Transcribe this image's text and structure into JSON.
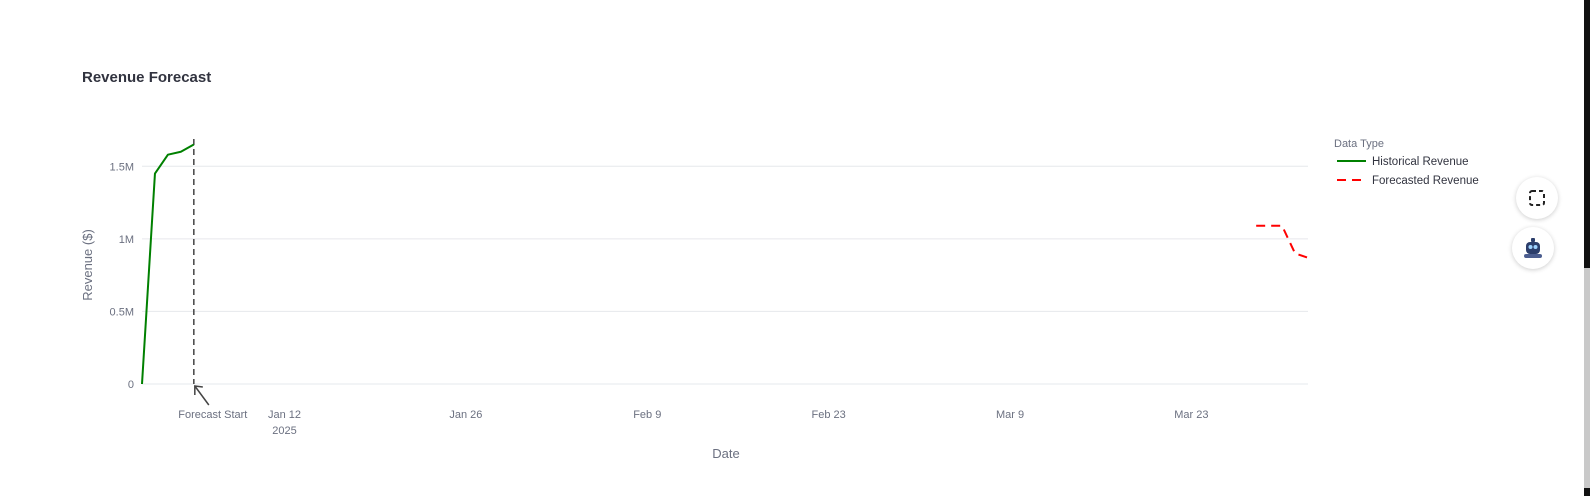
{
  "chart_data": {
    "type": "line",
    "title": "Revenue Forecast",
    "xlabel": "Date",
    "ylabel": "Revenue ($)",
    "xlim": [
      "2025-01-01",
      "2025-04-01"
    ],
    "ylim": [
      0,
      1750000
    ],
    "grid": true,
    "x_ticks": [
      {
        "date": "2025-01-12",
        "label": "Jan 12",
        "sublabel": "2025"
      },
      {
        "date": "2025-01-26",
        "label": "Jan 26"
      },
      {
        "date": "2025-02-09",
        "label": "Feb 9"
      },
      {
        "date": "2025-02-23",
        "label": "Feb 23"
      },
      {
        "date": "2025-03-09",
        "label": "Mar 9"
      },
      {
        "date": "2025-03-23",
        "label": "Mar 23"
      }
    ],
    "y_ticks": [
      {
        "value": 0,
        "label": "0"
      },
      {
        "value": 500000,
        "label": "0.5M"
      },
      {
        "value": 1000000,
        "label": "1M"
      },
      {
        "value": 1500000,
        "label": "1.5M"
      }
    ],
    "legend": {
      "title": "Data Type",
      "position": "top-right"
    },
    "series": [
      {
        "name": "Historical Revenue",
        "color": "#008000",
        "dash": "solid",
        "points": [
          {
            "x": "2025-01-01",
            "y": 0
          },
          {
            "x": "2025-01-02",
            "y": 1450000
          },
          {
            "x": "2025-01-03",
            "y": 1580000
          },
          {
            "x": "2025-01-04",
            "y": 1600000
          },
          {
            "x": "2025-01-05",
            "y": 1650000
          }
        ]
      },
      {
        "name": "Forecasted Revenue",
        "color": "#ff0000",
        "dash": "dashed",
        "points": [
          {
            "x": "2025-03-28",
            "y": 1090000
          },
          {
            "x": "2025-03-29",
            "y": 1090000
          },
          {
            "x": "2025-03-30",
            "y": 1090000
          },
          {
            "x": "2025-03-31",
            "y": 900000
          },
          {
            "x": "2025-04-01",
            "y": 870000
          }
        ]
      }
    ],
    "annotations": [
      {
        "x": "2025-01-05",
        "text": "Forecast Start",
        "type": "vertical-line"
      }
    ]
  },
  "side_buttons": [
    {
      "icon": "screenshot-select-icon"
    },
    {
      "icon": "assistant-avatar-icon"
    }
  ]
}
